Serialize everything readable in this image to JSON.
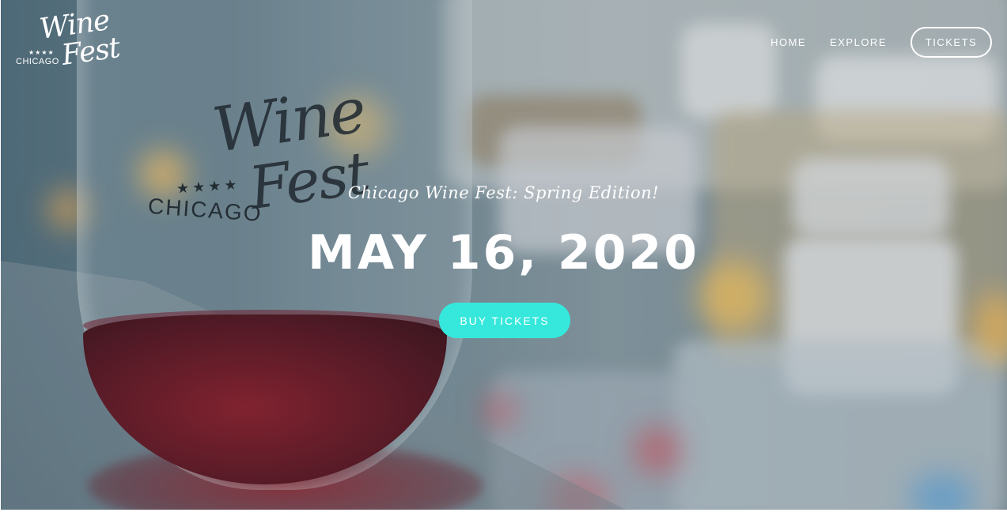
{
  "site": {
    "logo": {
      "line1": "Wine",
      "line2": "Fest",
      "stars": "★★★★",
      "city": "CHICAGO"
    }
  },
  "nav": {
    "items": [
      {
        "label": "HOME"
      },
      {
        "label": "EXPLORE"
      }
    ],
    "tickets_label": "TICKETS"
  },
  "hero": {
    "subtitle": "Chicago Wine Fest: Spring Edition!",
    "date": "MAY 16, 2020",
    "cta_label": "BUY TICKETS",
    "glass_print": {
      "line1": "Wine",
      "line2": "Fest",
      "stars": "★★★★",
      "city": "CHICAGO"
    }
  },
  "colors": {
    "accent": "#36e8dc",
    "text": "#ffffff",
    "wine": "#8e1622"
  }
}
